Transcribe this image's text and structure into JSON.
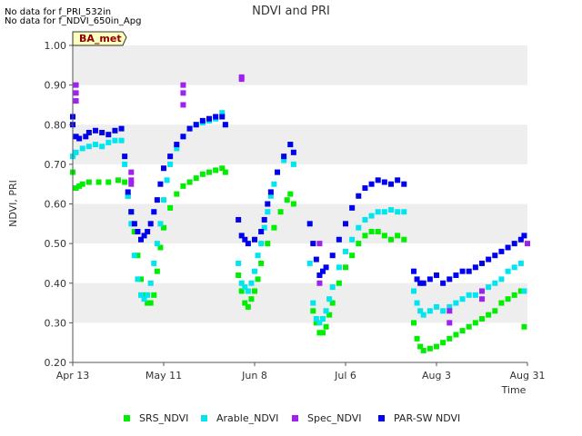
{
  "notices": [
    "No data for f_PRI_532in",
    "No data for f_NDVI_650in_Apg"
  ],
  "chart_data": {
    "type": "scatter",
    "title": "NDVI and PRI",
    "site_tag": "BA_met",
    "xlabel": "Time",
    "ylabel": "NDVI, PRI",
    "xlim": [
      0,
      140
    ],
    "ylim": [
      0.2,
      1.0
    ],
    "x_ticks": [
      {
        "x": 0,
        "label": "Apr 13"
      },
      {
        "x": 28,
        "label": "May 11"
      },
      {
        "x": 56,
        "label": "Jun 8"
      },
      {
        "x": 84,
        "label": "Jul 6"
      },
      {
        "x": 112,
        "label": "Aug 3"
      },
      {
        "x": 140,
        "label": "Aug 31"
      }
    ],
    "y_ticks": [
      0.2,
      0.3,
      0.4,
      0.5,
      0.6,
      0.7,
      0.8,
      0.9,
      1.0
    ],
    "y_tick_labels": [
      "0.20",
      "0.30",
      "0.40",
      "0.50",
      "0.60",
      "0.70",
      "0.80",
      "0.90",
      "1.00"
    ],
    "grid": "horizontal-bands",
    "legend_position": "bottom",
    "series": [
      {
        "name": "SRS_NDVI",
        "color": "#00ee00",
        "points": [
          [
            0,
            0.68
          ],
          [
            1,
            0.64
          ],
          [
            2,
            0.645
          ],
          [
            3,
            0.65
          ],
          [
            5,
            0.655
          ],
          [
            8,
            0.655
          ],
          [
            11,
            0.655
          ],
          [
            14,
            0.66
          ],
          [
            16,
            0.655
          ],
          [
            17,
            0.62
          ],
          [
            18,
            0.58
          ],
          [
            19,
            0.53
          ],
          [
            20,
            0.47
          ],
          [
            21,
            0.41
          ],
          [
            22,
            0.37
          ],
          [
            23,
            0.35
          ],
          [
            24,
            0.35
          ],
          [
            25,
            0.37
          ],
          [
            26,
            0.43
          ],
          [
            27,
            0.49
          ],
          [
            28,
            0.54
          ],
          [
            30,
            0.59
          ],
          [
            32,
            0.625
          ],
          [
            34,
            0.645
          ],
          [
            36,
            0.655
          ],
          [
            38,
            0.665
          ],
          [
            40,
            0.675
          ],
          [
            42,
            0.68
          ],
          [
            44,
            0.685
          ],
          [
            46,
            0.69
          ],
          [
            47,
            0.68
          ],
          [
            51,
            0.42
          ],
          [
            52,
            0.38
          ],
          [
            53,
            0.35
          ],
          [
            54,
            0.34
          ],
          [
            55,
            0.36
          ],
          [
            56,
            0.38
          ],
          [
            57,
            0.41
          ],
          [
            58,
            0.45
          ],
          [
            60,
            0.5
          ],
          [
            62,
            0.54
          ],
          [
            64,
            0.58
          ],
          [
            66,
            0.61
          ],
          [
            67,
            0.625
          ],
          [
            68,
            0.6
          ],
          [
            74,
            0.33
          ],
          [
            75,
            0.3
          ],
          [
            76,
            0.275
          ],
          [
            77,
            0.275
          ],
          [
            78,
            0.29
          ],
          [
            79,
            0.32
          ],
          [
            80,
            0.35
          ],
          [
            82,
            0.4
          ],
          [
            84,
            0.44
          ],
          [
            86,
            0.47
          ],
          [
            88,
            0.5
          ],
          [
            90,
            0.52
          ],
          [
            92,
            0.53
          ],
          [
            94,
            0.53
          ],
          [
            96,
            0.52
          ],
          [
            98,
            0.51
          ],
          [
            100,
            0.52
          ],
          [
            102,
            0.51
          ],
          [
            105,
            0.3
          ],
          [
            106,
            0.26
          ],
          [
            107,
            0.24
          ],
          [
            108,
            0.23
          ],
          [
            110,
            0.235
          ],
          [
            112,
            0.24
          ],
          [
            114,
            0.25
          ],
          [
            116,
            0.26
          ],
          [
            118,
            0.27
          ],
          [
            120,
            0.28
          ],
          [
            122,
            0.29
          ],
          [
            124,
            0.3
          ],
          [
            126,
            0.31
          ],
          [
            128,
            0.32
          ],
          [
            130,
            0.33
          ],
          [
            132,
            0.35
          ],
          [
            134,
            0.36
          ],
          [
            136,
            0.37
          ],
          [
            138,
            0.38
          ],
          [
            139,
            0.29
          ]
        ]
      },
      {
        "name": "Arable_NDVI",
        "color": "#00e5ee",
        "points": [
          [
            0,
            0.72
          ],
          [
            1,
            0.73
          ],
          [
            3,
            0.74
          ],
          [
            5,
            0.745
          ],
          [
            7,
            0.75
          ],
          [
            9,
            0.745
          ],
          [
            11,
            0.755
          ],
          [
            13,
            0.76
          ],
          [
            15,
            0.76
          ],
          [
            16,
            0.7
          ],
          [
            17,
            0.62
          ],
          [
            18,
            0.55
          ],
          [
            19,
            0.47
          ],
          [
            20,
            0.41
          ],
          [
            21,
            0.37
          ],
          [
            22,
            0.36
          ],
          [
            23,
            0.37
          ],
          [
            24,
            0.4
          ],
          [
            25,
            0.45
          ],
          [
            26,
            0.5
          ],
          [
            27,
            0.55
          ],
          [
            28,
            0.61
          ],
          [
            29,
            0.66
          ],
          [
            30,
            0.7
          ],
          [
            32,
            0.74
          ],
          [
            34,
            0.77
          ],
          [
            36,
            0.79
          ],
          [
            38,
            0.8
          ],
          [
            40,
            0.805
          ],
          [
            42,
            0.81
          ],
          [
            44,
            0.815
          ],
          [
            46,
            0.83
          ],
          [
            47,
            0.8
          ],
          [
            51,
            0.45
          ],
          [
            52,
            0.4
          ],
          [
            53,
            0.39
          ],
          [
            54,
            0.38
          ],
          [
            55,
            0.4
          ],
          [
            56,
            0.43
          ],
          [
            57,
            0.47
          ],
          [
            58,
            0.5
          ],
          [
            59,
            0.54
          ],
          [
            60,
            0.58
          ],
          [
            61,
            0.62
          ],
          [
            62,
            0.65
          ],
          [
            63,
            0.68
          ],
          [
            65,
            0.71
          ],
          [
            67,
            0.75
          ],
          [
            68,
            0.7
          ],
          [
            73,
            0.45
          ],
          [
            74,
            0.35
          ],
          [
            75,
            0.31
          ],
          [
            76,
            0.3
          ],
          [
            77,
            0.31
          ],
          [
            78,
            0.33
          ],
          [
            79,
            0.36
          ],
          [
            80,
            0.39
          ],
          [
            82,
            0.44
          ],
          [
            84,
            0.48
          ],
          [
            86,
            0.51
          ],
          [
            88,
            0.54
          ],
          [
            90,
            0.56
          ],
          [
            92,
            0.57
          ],
          [
            94,
            0.58
          ],
          [
            96,
            0.58
          ],
          [
            98,
            0.585
          ],
          [
            100,
            0.58
          ],
          [
            102,
            0.58
          ],
          [
            105,
            0.38
          ],
          [
            106,
            0.35
          ],
          [
            107,
            0.33
          ],
          [
            108,
            0.32
          ],
          [
            110,
            0.33
          ],
          [
            112,
            0.34
          ],
          [
            114,
            0.33
          ],
          [
            116,
            0.34
          ],
          [
            118,
            0.35
          ],
          [
            120,
            0.36
          ],
          [
            122,
            0.37
          ],
          [
            124,
            0.37
          ],
          [
            126,
            0.38
          ],
          [
            128,
            0.39
          ],
          [
            130,
            0.4
          ],
          [
            132,
            0.41
          ],
          [
            134,
            0.43
          ],
          [
            136,
            0.44
          ],
          [
            138,
            0.45
          ],
          [
            139,
            0.38
          ]
        ]
      },
      {
        "name": "Spec_NDVI",
        "color": "#a020f0",
        "points": [
          [
            1,
            0.88
          ],
          [
            1,
            0.9
          ],
          [
            1,
            0.86
          ],
          [
            18,
            0.68
          ],
          [
            18,
            0.66
          ],
          [
            18,
            0.65
          ],
          [
            34,
            0.9
          ],
          [
            34,
            0.88
          ],
          [
            34,
            0.85
          ],
          [
            52,
            0.92
          ],
          [
            52,
            0.915
          ],
          [
            76,
            0.5
          ],
          [
            76,
            0.42
          ],
          [
            76,
            0.4
          ],
          [
            116,
            0.33
          ],
          [
            116,
            0.3
          ],
          [
            126,
            0.38
          ],
          [
            126,
            0.36
          ],
          [
            140,
            0.5
          ]
        ]
      },
      {
        "name": "PAR-SW NDVI",
        "color": "#0000ee",
        "points": [
          [
            0,
            0.82
          ],
          [
            0,
            0.8
          ],
          [
            1,
            0.77
          ],
          [
            2,
            0.765
          ],
          [
            4,
            0.77
          ],
          [
            5,
            0.78
          ],
          [
            7,
            0.785
          ],
          [
            9,
            0.78
          ],
          [
            11,
            0.775
          ],
          [
            13,
            0.785
          ],
          [
            15,
            0.79
          ],
          [
            16,
            0.72
          ],
          [
            17,
            0.63
          ],
          [
            18,
            0.58
          ],
          [
            19,
            0.55
          ],
          [
            20,
            0.53
          ],
          [
            21,
            0.51
          ],
          [
            22,
            0.52
          ],
          [
            23,
            0.53
          ],
          [
            24,
            0.55
          ],
          [
            25,
            0.58
          ],
          [
            26,
            0.61
          ],
          [
            27,
            0.65
          ],
          [
            28,
            0.69
          ],
          [
            30,
            0.72
          ],
          [
            32,
            0.75
          ],
          [
            34,
            0.77
          ],
          [
            36,
            0.79
          ],
          [
            38,
            0.8
          ],
          [
            40,
            0.81
          ],
          [
            42,
            0.815
          ],
          [
            44,
            0.82
          ],
          [
            46,
            0.82
          ],
          [
            47,
            0.8
          ],
          [
            51,
            0.56
          ],
          [
            52,
            0.52
          ],
          [
            53,
            0.51
          ],
          [
            54,
            0.5
          ],
          [
            56,
            0.51
          ],
          [
            58,
            0.53
          ],
          [
            59,
            0.56
          ],
          [
            60,
            0.6
          ],
          [
            61,
            0.63
          ],
          [
            63,
            0.68
          ],
          [
            65,
            0.72
          ],
          [
            67,
            0.75
          ],
          [
            68,
            0.73
          ],
          [
            73,
            0.55
          ],
          [
            74,
            0.5
          ],
          [
            75,
            0.46
          ],
          [
            76,
            0.42
          ],
          [
            77,
            0.43
          ],
          [
            78,
            0.44
          ],
          [
            80,
            0.47
          ],
          [
            82,
            0.51
          ],
          [
            84,
            0.55
          ],
          [
            86,
            0.59
          ],
          [
            88,
            0.62
          ],
          [
            90,
            0.64
          ],
          [
            92,
            0.65
          ],
          [
            94,
            0.66
          ],
          [
            96,
            0.655
          ],
          [
            98,
            0.65
          ],
          [
            100,
            0.66
          ],
          [
            102,
            0.65
          ],
          [
            105,
            0.43
          ],
          [
            106,
            0.41
          ],
          [
            107,
            0.4
          ],
          [
            108,
            0.4
          ],
          [
            110,
            0.41
          ],
          [
            112,
            0.42
          ],
          [
            114,
            0.4
          ],
          [
            116,
            0.41
          ],
          [
            118,
            0.42
          ],
          [
            120,
            0.43
          ],
          [
            122,
            0.43
          ],
          [
            124,
            0.44
          ],
          [
            126,
            0.45
          ],
          [
            128,
            0.46
          ],
          [
            130,
            0.47
          ],
          [
            132,
            0.48
          ],
          [
            134,
            0.49
          ],
          [
            136,
            0.5
          ],
          [
            138,
            0.51
          ],
          [
            139,
            0.52
          ]
        ]
      }
    ]
  }
}
